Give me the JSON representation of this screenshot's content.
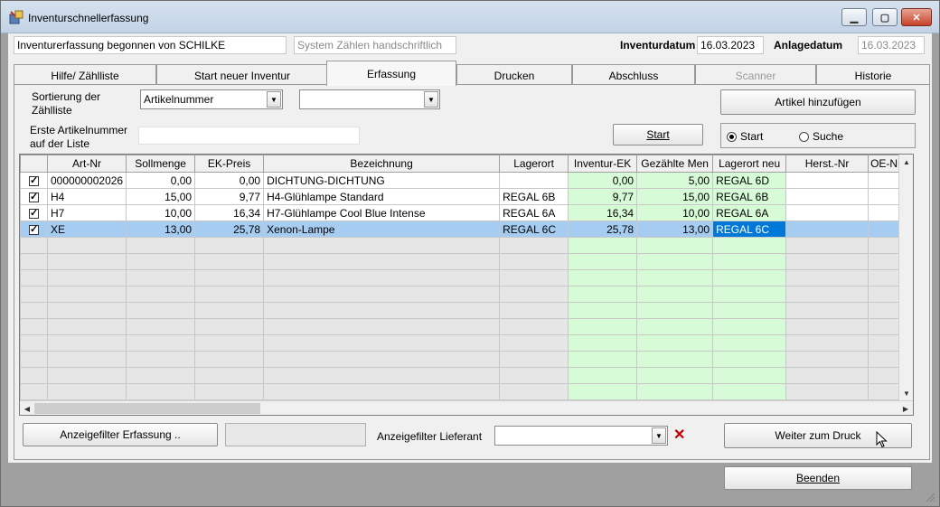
{
  "window": {
    "title": "Inventurschnellerfassung"
  },
  "header": {
    "started_by": "Inventurerfassung begonnen von SCHILKE",
    "count_system": "System Zählen handschriftlich",
    "inventory_date_label": "Inventurdatum",
    "inventory_date": "16.03.2023",
    "created_date_label": "Anlagedatum",
    "created_date": "16.03.2023"
  },
  "tabs": [
    {
      "label": "Hilfe/ Zählliste"
    },
    {
      "label": "Start neuer Inventur"
    },
    {
      "label": "Erfassung"
    },
    {
      "label": "Drucken"
    },
    {
      "label": "Abschluss"
    },
    {
      "label": "Scanner"
    },
    {
      "label": "Historie"
    }
  ],
  "panel": {
    "sort_label_1": "Sortierung der",
    "sort_label_2": "Zählliste",
    "sort_value": "Artikelnummer",
    "sort_value_2": "",
    "first_art_label_1": "Erste Artikelnummer",
    "first_art_label_2": "auf der Liste",
    "first_art_value": "",
    "add_article_button": "Artikel hinzufügen",
    "start_button": "Start",
    "radio_start": "Start",
    "radio_search": "Suche"
  },
  "grid": {
    "columns": [
      "",
      "Art-Nr",
      "Sollmenge",
      "EK-Preis",
      "Bezeichnung",
      "Lagerort",
      "Inventur-EK",
      "Gezählte Men",
      "Lagerort neu",
      "Herst.-Nr",
      "OE-Nu"
    ],
    "rows": [
      [
        "000000002026",
        "0,00",
        "0,00",
        "DICHTUNG-DICHTUNG",
        "",
        "0,00",
        "5,00",
        "REGAL 6D",
        "",
        ""
      ],
      [
        "H4",
        "15,00",
        "9,77",
        "H4-Glühlampe Standard",
        "REGAL 6B",
        "9,77",
        "15,00",
        "REGAL 6B",
        "",
        ""
      ],
      [
        "H7",
        "10,00",
        "16,34",
        "H7-Glühlampe Cool Blue Intense",
        "REGAL 6A",
        "16,34",
        "10,00",
        "REGAL 6A",
        "",
        ""
      ],
      [
        "XE",
        "13,00",
        "25,78",
        "Xenon-Lampe",
        "REGAL 6C",
        "25,78",
        "13,00",
        "REGAL 6C",
        "",
        ""
      ]
    ]
  },
  "footer": {
    "filter_capture_button": "Anzeigefilter Erfassung ..",
    "filter_capture_value": "",
    "filter_supplier_label": "Anzeigefilter Lieferant",
    "filter_supplier_value": "",
    "next_print_button": "Weiter zum Druck",
    "exit_button": "Beenden"
  },
  "colors": {
    "green_column": "#d7fbd7",
    "selection": "#a6cdf1",
    "selection_focus": "#0078d7",
    "clear_x": "#c00000"
  }
}
